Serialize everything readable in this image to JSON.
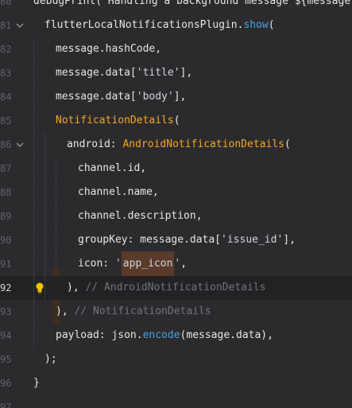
{
  "lines": [
    {
      "num": "80",
      "code": "debugPrint('Handling a background message ${message.me",
      "cls": "tok-default"
    },
    {
      "num": "81",
      "parts": [
        [
          "flutterLocalNotificationsPlugin.",
          "tok-default"
        ],
        [
          "show",
          "tok-method"
        ],
        [
          "(",
          "tok-default"
        ]
      ]
    },
    {
      "num": "82",
      "code": "message.hashCode,",
      "cls": "tok-default"
    },
    {
      "num": "83",
      "parts": [
        [
          "message.data[",
          "tok-default"
        ],
        [
          "'title'",
          "tok-string"
        ],
        [
          "],",
          "tok-default"
        ]
      ]
    },
    {
      "num": "84",
      "parts": [
        [
          "message.data[",
          "tok-default"
        ],
        [
          "'body'",
          "tok-string"
        ],
        [
          "],",
          "tok-default"
        ]
      ]
    },
    {
      "num": "85",
      "parts": [
        [
          "NotificationDetails",
          "tok-class"
        ],
        [
          "(",
          "tok-default"
        ]
      ]
    },
    {
      "num": "86",
      "parts": [
        [
          "android: ",
          "tok-default"
        ],
        [
          "AndroidNotificationDetails",
          "tok-class"
        ],
        [
          "(",
          "tok-default"
        ]
      ]
    },
    {
      "num": "87",
      "code": "channel.id,",
      "cls": "tok-default"
    },
    {
      "num": "88",
      "code": "channel.name,",
      "cls": "tok-default"
    },
    {
      "num": "89",
      "code": "channel.description,",
      "cls": "tok-default"
    },
    {
      "num": "90",
      "parts": [
        [
          "groupKey: message.data[",
          "tok-default"
        ],
        [
          "'issue_id'",
          "tok-string"
        ],
        [
          "],",
          "tok-default"
        ]
      ]
    },
    {
      "num": "91",
      "parts": [
        [
          "icon: ",
          "tok-default"
        ],
        [
          "'",
          "tok-string"
        ],
        [
          "app_icon",
          "tok-string hl"
        ],
        [
          "'",
          "tok-string"
        ],
        [
          ",",
          "tok-default"
        ]
      ]
    },
    {
      "num": "92",
      "parts": [
        [
          "), ",
          "tok-default"
        ],
        [
          "// AndroidNotificationDetails",
          "tok-comment"
        ]
      ]
    },
    {
      "num": "93",
      "parts": [
        [
          "), ",
          "tok-default"
        ],
        [
          "// NotificationDetails",
          "tok-comment"
        ]
      ]
    },
    {
      "num": "94",
      "parts": [
        [
          "payload: json.",
          "tok-default"
        ],
        [
          "encode",
          "tok-method"
        ],
        [
          "(message.data),",
          "tok-default"
        ]
      ]
    },
    {
      "num": "95",
      "code": ");",
      "cls": "tok-default"
    },
    {
      "num": "96",
      "code": "}",
      "cls": "tok-default"
    },
    {
      "num": "97",
      "code": "",
      "cls": "tok-default"
    }
  ],
  "icons": {
    "fold": "chevron-down-icon",
    "hint": "lightbulb-icon"
  },
  "colors": {
    "background": "#2b2b2d",
    "current_line": "#222224",
    "class": "#f5a623",
    "method": "#4aa3e8",
    "comment": "#6d7680",
    "highlight": "#5a3a2a"
  }
}
